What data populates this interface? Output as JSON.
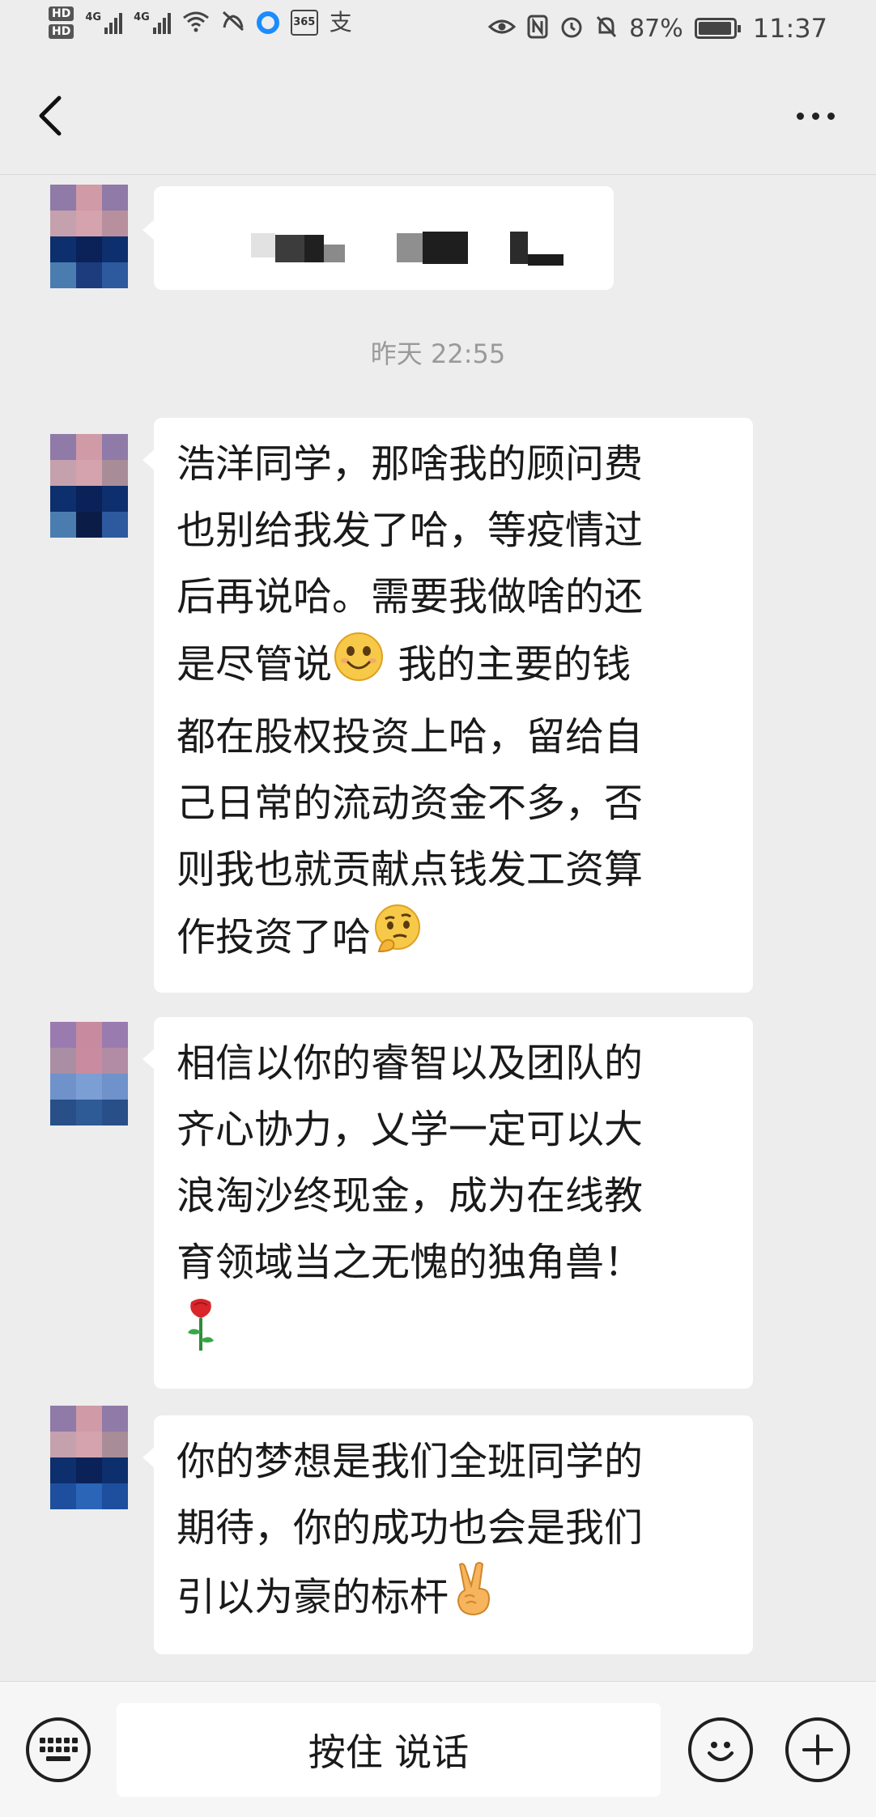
{
  "status_bar": {
    "hd1": "HD",
    "hd2": "HD",
    "sig1_label": "4G",
    "sig2_label": "4G",
    "cal_label": "365",
    "pay_icon": "支",
    "battery": "87%",
    "time": "11:37"
  },
  "header": {
    "title": ""
  },
  "chat": {
    "timestamp": "昨天 22:55",
    "messages": [
      {
        "lines": [
          "浩洋同学，那啥我的顾问费",
          "也别给我发了哈，等疫情过",
          "后再说哈。需要我做啥的还",
          "是尽管说",
          "都在股权投资上哈，留给自",
          "己日常的流动资金不多，否",
          "则我也就贡献点钱发工资算",
          "作投资了哈"
        ],
        "line4_tail": " 我的主要的钱",
        "emoji_smile": "smile-emoji",
        "emoji_think": "thinking-emoji"
      },
      {
        "lines": [
          "相信以你的睿智以及团队的",
          "齐心协力，乂学一定可以大",
          "浪淘沙终现金，成为在线教",
          "育领域当之无愧的独角兽！"
        ],
        "emoji_rose": "rose-emoji"
      },
      {
        "lines": [
          "你的梦想是我们全班同学的",
          "期待，你的成功也会是我们",
          "引以为豪的标杆"
        ],
        "emoji_victory": "victory-hand-emoji"
      }
    ]
  },
  "bottom_bar": {
    "voice_label": "按住 说话",
    "keyboard_icon": "keyboard-icon",
    "emoji_icon": "emoji-icon",
    "plus_icon": "plus-icon"
  },
  "colors": {
    "background": "#ededed",
    "bubble": "#ffffff",
    "timestamp": "#9a9a9a"
  }
}
